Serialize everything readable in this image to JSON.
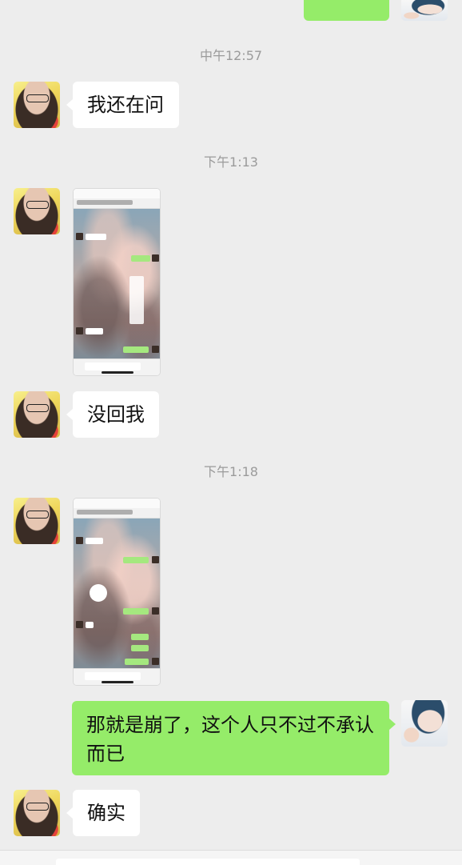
{
  "timestamps": [
    "中午12:57",
    "下午1:13",
    "下午1:18"
  ],
  "messages": [
    {
      "side": "left",
      "text": "我还在问"
    },
    {
      "side": "left",
      "type": "image",
      "description": "screenshot"
    },
    {
      "side": "left",
      "text": "没回我"
    },
    {
      "side": "left",
      "type": "image",
      "description": "screenshot"
    },
    {
      "side": "right",
      "text": "那就是崩了，这个人只不过不承认而已"
    },
    {
      "side": "left",
      "text": "确实"
    }
  ],
  "bubble_colors": {
    "incoming": "#ffffff",
    "outgoing": "#95ec69",
    "background": "#ededed"
  },
  "icons": [
    "avatar-female",
    "avatar-cartoon"
  ]
}
